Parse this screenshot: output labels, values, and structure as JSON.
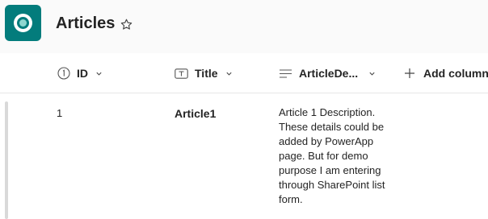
{
  "header": {
    "title": "Articles",
    "logo_icon": "sharepoint-list-app-icon",
    "favorite_icon": "star-outline-icon",
    "accent_color": "#037c7c"
  },
  "columns": [
    {
      "label": "ID",
      "icon": "number-circle-icon"
    },
    {
      "label": "Title",
      "icon": "text-field-icon"
    },
    {
      "label": "ArticleDe...",
      "icon": "multiline-text-icon"
    },
    {
      "label": "Add column",
      "icon": "plus-icon"
    }
  ],
  "rows": [
    {
      "id": "1",
      "title": "Article1",
      "description": "Article 1 Description. These details could be added by PowerApp page. But for demo purpose I am entering through SharePoint list form."
    }
  ]
}
